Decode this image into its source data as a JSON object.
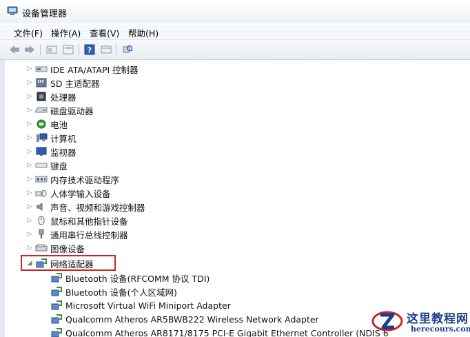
{
  "window": {
    "title": "设备管理器"
  },
  "menu": [
    "文件(F)",
    "操作(A)",
    "查看(V)",
    "帮助(H)"
  ],
  "toolbar": {
    "buttons": [
      "back-icon",
      "forward-icon",
      "properties-icon",
      "update-icon",
      "help-icon",
      "view-icon",
      "scan-hardware-icon"
    ]
  },
  "tree": {
    "categories": [
      {
        "label": "IDE ATA/ATAPI 控制器",
        "icon": "ide-controller-icon"
      },
      {
        "label": "SD 主适配器",
        "icon": "sd-host-icon"
      },
      {
        "label": "处理器",
        "icon": "processor-icon"
      },
      {
        "label": "磁盘驱动器",
        "icon": "disk-drive-icon"
      },
      {
        "label": "电池",
        "icon": "battery-icon"
      },
      {
        "label": "计算机",
        "icon": "computer-icon"
      },
      {
        "label": "监视器",
        "icon": "monitor-icon"
      },
      {
        "label": "键盘",
        "icon": "keyboard-icon"
      },
      {
        "label": "内存技术驱动程序",
        "icon": "memory-tech-icon"
      },
      {
        "label": "人体学输入设备",
        "icon": "hid-icon"
      },
      {
        "label": "声音、视频和游戏控制器",
        "icon": "sound-icon"
      },
      {
        "label": "鼠标和其他指针设备",
        "icon": "mouse-icon"
      },
      {
        "label": "通用串行总线控制器",
        "icon": "usb-icon"
      },
      {
        "label": "图像设备",
        "icon": "imaging-icon"
      },
      {
        "label": "网络适配器",
        "icon": "network-adapter-icon",
        "expanded": true
      }
    ],
    "network_adapters": [
      "Bluetooth 设备(RFCOMM 协议 TDI)",
      "Bluetooth 设备(个人区域网)",
      "Microsoft Virtual WiFi Miniport Adapter",
      "Qualcomm Atheros AR5BWB222 Wireless Network Adapter",
      "Qualcomm Atheros AR8171/8175 PCI-E Gigabit Ethernet Controller (NDIS 6"
    ]
  },
  "watermark": {
    "title": "这里教程网",
    "url": "herecours.com"
  },
  "colors": {
    "highlight": "#c9252b",
    "watermark": "#1c3d8c"
  }
}
